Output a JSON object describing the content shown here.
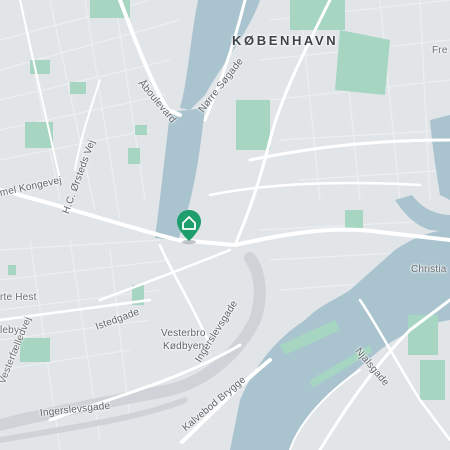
{
  "map": {
    "city": "KØBENHAVN",
    "districts": [
      {
        "name": "Vesterbro"
      },
      {
        "name": "Kødbyen"
      }
    ],
    "streets": [
      {
        "name": "Åboulevard"
      },
      {
        "name": "Nørre Søgade"
      },
      {
        "name": "H.C. Ørsteds Vej"
      },
      {
        "name": "Gammel Kongevej",
        "shown": "mel Kongevej"
      },
      {
        "name": "Istedgade"
      },
      {
        "name": "Ingerslevsgade"
      },
      {
        "name": "Kalvebod Brygge"
      },
      {
        "name": "Njalsgade"
      }
    ],
    "edge_labels": {
      "top_right": "Fre",
      "right": "Christia",
      "left_1": "rte Hest",
      "left_2": "leby",
      "left_3": "Vesterfælledvej"
    },
    "marker": {
      "icon": "home-icon",
      "color": "#1e9e6c"
    },
    "colors": {
      "land": "#e2e5e8",
      "water": "#a9c4cf",
      "park": "#a6d6c2",
      "road": "#ffffff",
      "rail": "#cfd3d7"
    }
  }
}
